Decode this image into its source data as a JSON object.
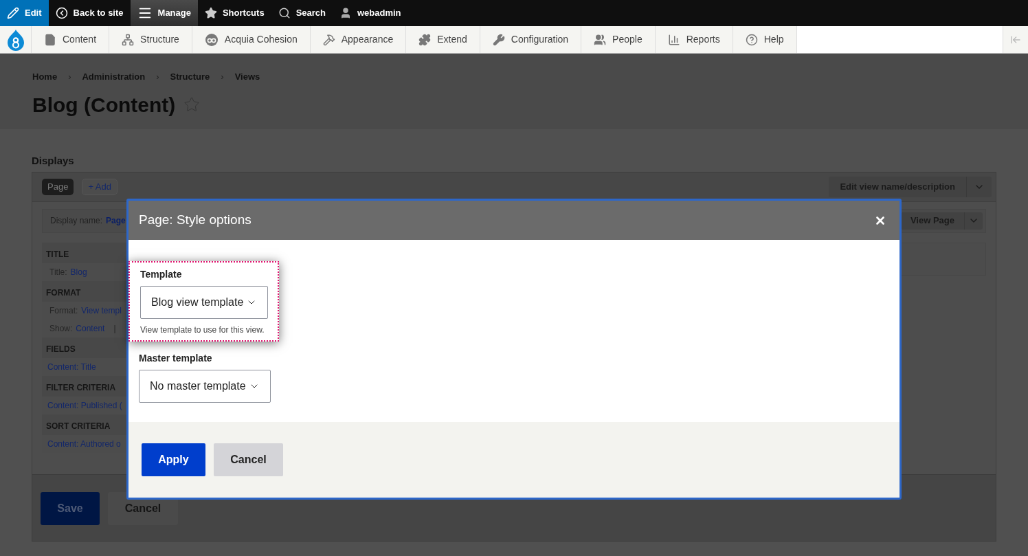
{
  "toolbar": {
    "items": [
      {
        "label": "Edit",
        "kind": "edit",
        "selected": true
      },
      {
        "label": "Back to site",
        "kind": "back",
        "selected": false
      },
      {
        "label": "Manage",
        "kind": "manage",
        "selected": true
      },
      {
        "label": "Shortcuts",
        "kind": "shortcuts",
        "selected": false
      },
      {
        "label": "Search",
        "kind": "search",
        "selected": false
      },
      {
        "label": "webadmin",
        "kind": "user",
        "selected": false
      }
    ]
  },
  "admin_menu": {
    "items": [
      {
        "label": "Content",
        "kind": "content"
      },
      {
        "label": "Structure",
        "kind": "structure"
      },
      {
        "label": "Acquia Cohesion",
        "kind": "cohesion"
      },
      {
        "label": "Appearance",
        "kind": "appearance"
      },
      {
        "label": "Extend",
        "kind": "extend"
      },
      {
        "label": "Configuration",
        "kind": "configuration"
      },
      {
        "label": "People",
        "kind": "people"
      },
      {
        "label": "Reports",
        "kind": "reports"
      },
      {
        "label": "Help",
        "kind": "help"
      }
    ]
  },
  "breadcrumb": [
    {
      "label": "Home"
    },
    {
      "separator": "›",
      "label": "Administration"
    },
    {
      "separator": "›",
      "label": "Structure"
    },
    {
      "separator": "›",
      "label": "Views"
    }
  ],
  "page_title": "Blog (Content)",
  "displays": {
    "heading": "Displays",
    "tabs": [
      {
        "label": "Page",
        "selected": true
      },
      {
        "label": "+ Add",
        "selected": false
      }
    ],
    "edit_button": "Edit view name/description",
    "display_name_label": "Display name:",
    "display_name": "Page",
    "view_button": "View Page",
    "sections": [
      {
        "heading": "TITLE",
        "rows": [
          {
            "label": "Title:",
            "value": "Blog"
          }
        ]
      },
      {
        "heading": "FORMAT",
        "rows": [
          {
            "label": "Format:",
            "value": "View templ"
          },
          {
            "label": "Show:",
            "value": "Content",
            "separator": "|"
          }
        ]
      },
      {
        "heading": "FIELDS",
        "rows": [
          {
            "value": "Content: Title"
          }
        ]
      },
      {
        "heading": "FILTER CRITERIA",
        "rows": [
          {
            "value": "Content: Published ("
          }
        ]
      },
      {
        "heading": "SORT CRITERIA",
        "rows": [
          {
            "value": "Content: Authored o"
          }
        ]
      }
    ],
    "buttons": [
      {
        "label": "Save",
        "kind": "primary"
      },
      {
        "label": "Cancel",
        "kind": "secondary"
      }
    ]
  },
  "dialog": {
    "title": "Page: Style options",
    "fields": [
      {
        "label": "Template",
        "value": "Blog view template",
        "description": "View template to use for this view.",
        "highlighted": true
      },
      {
        "label": "Master template",
        "value": "No master template",
        "highlighted": false
      }
    ],
    "buttons": [
      {
        "label": "Apply",
        "kind": "primary"
      },
      {
        "label": "Cancel",
        "kind": "secondary"
      }
    ]
  }
}
